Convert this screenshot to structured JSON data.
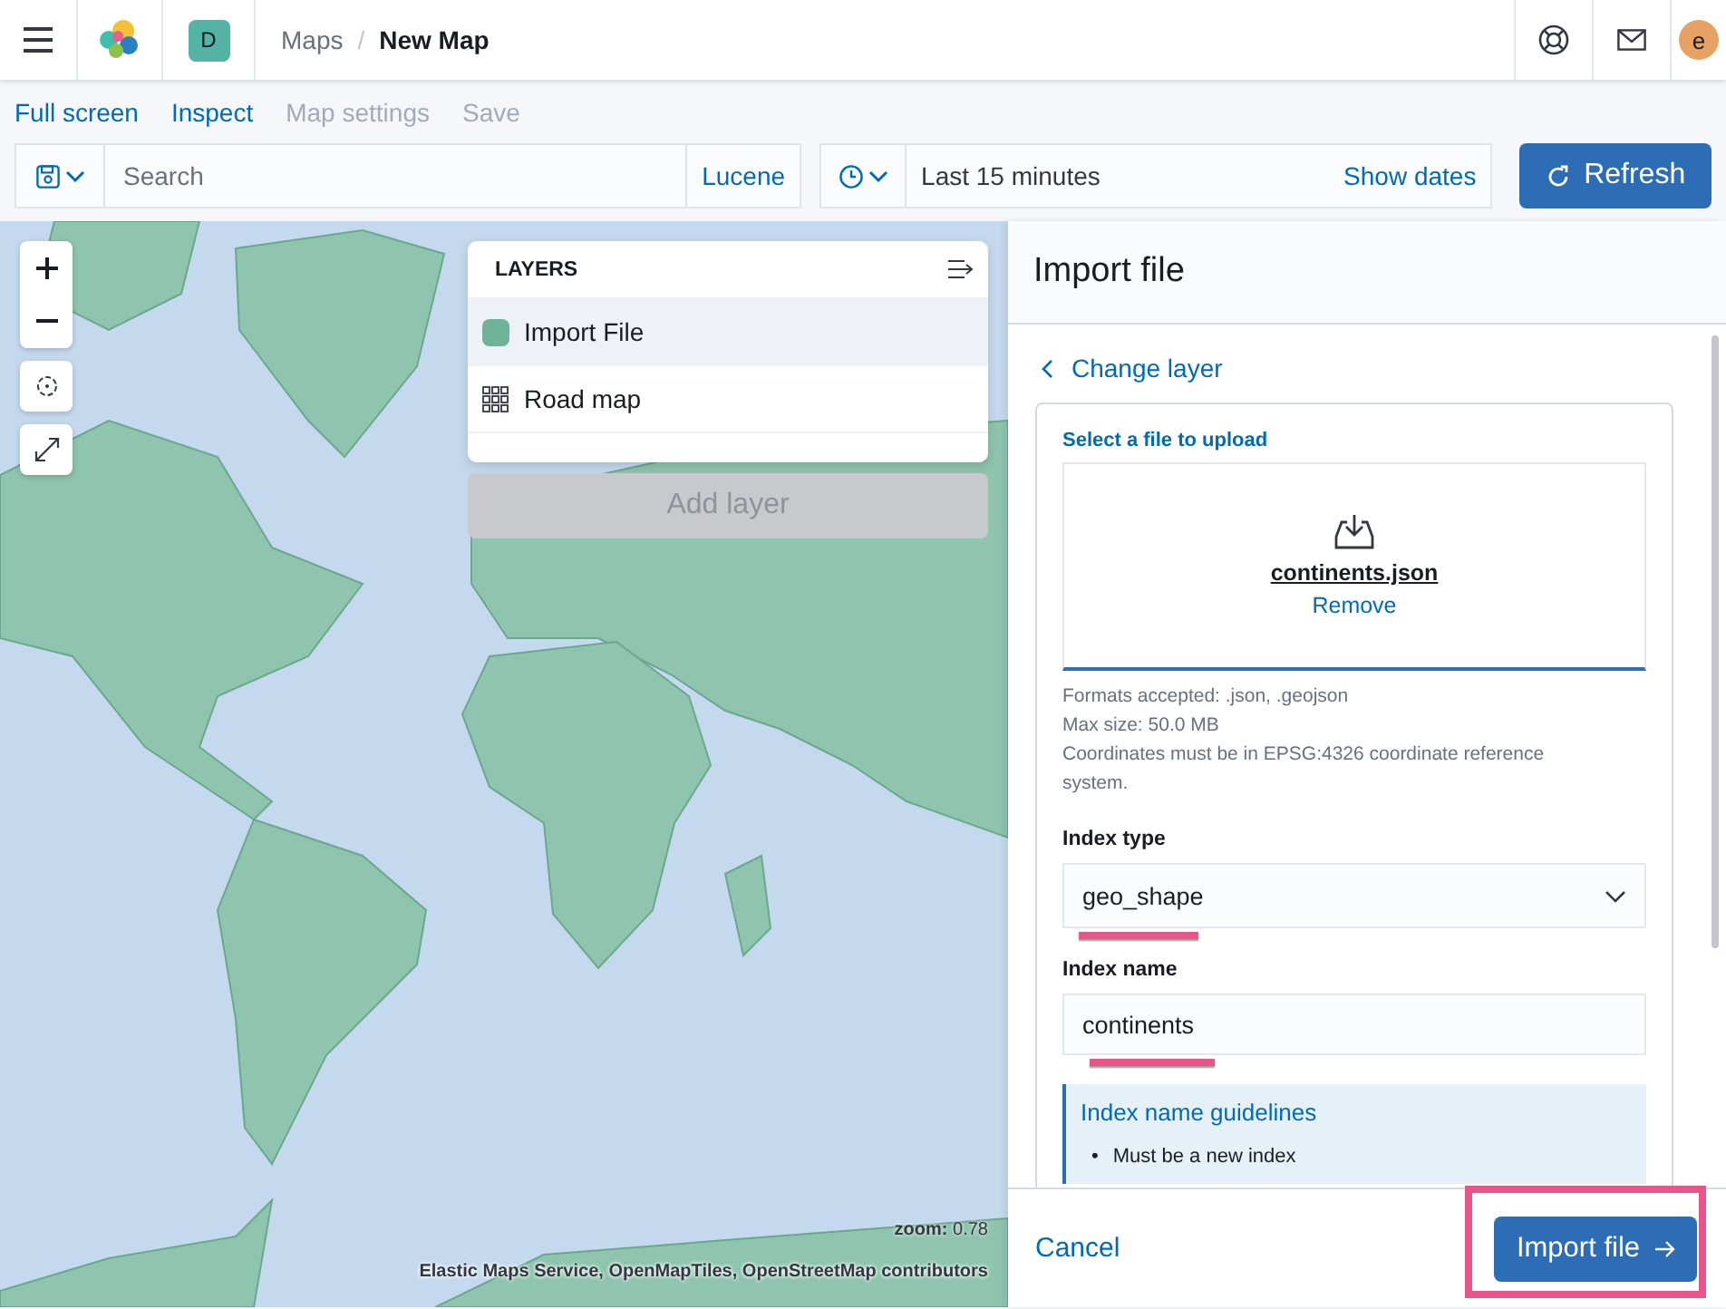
{
  "header": {
    "space_badge": "D",
    "separator": "/",
    "breadcrumbs": [
      {
        "label": "Maps",
        "current": false
      },
      {
        "label": "New Map",
        "current": true
      }
    ],
    "avatar": "e"
  },
  "top_nav": [
    {
      "label": "Full screen",
      "disabled": false
    },
    {
      "label": "Inspect",
      "disabled": false
    },
    {
      "label": "Map settings",
      "disabled": true
    },
    {
      "label": "Save",
      "disabled": true
    }
  ],
  "query_bar": {
    "search_placeholder": "Search",
    "language": "Lucene",
    "time_range": "Last 15 minutes",
    "show_dates": "Show dates",
    "refresh": "Refresh"
  },
  "layers": {
    "title": "LAYERS",
    "items": [
      {
        "name": "Import File",
        "kind": "vector",
        "selected": true
      },
      {
        "name": "Road map",
        "kind": "tiles",
        "selected": false
      }
    ],
    "add_button": {
      "label": "Add layer",
      "disabled": true
    }
  },
  "map": {
    "zoom_label": "zoom:",
    "zoom_value": "0.78",
    "attribution": "Elastic Maps Service, OpenMapTiles, OpenStreetMap contributors"
  },
  "import_panel": {
    "title": "Import file",
    "back_link": "Change layer",
    "file_picker": {
      "label": "Select a file to upload",
      "file_name": "continents.json",
      "remove": "Remove"
    },
    "help": [
      "Formats accepted: .json, .geojson",
      "Max size: 50.0 MB",
      "Coordinates must be in EPSG:4326 coordinate reference system."
    ],
    "index_type": {
      "label": "Index type",
      "value": "geo_shape",
      "underlined": true
    },
    "index_name": {
      "label": "Index name",
      "value": "continents",
      "underlined": true
    },
    "guidelines": {
      "title": "Index name guidelines",
      "bullet": "•",
      "items": [
        "Must be a new index"
      ]
    },
    "cancel": "Cancel",
    "submit": {
      "label": "Import file",
      "highlighted": true
    }
  }
}
